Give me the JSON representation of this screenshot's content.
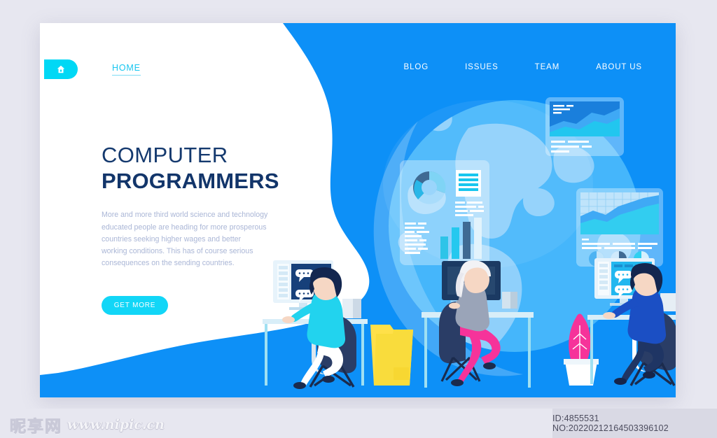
{
  "page": {
    "background_color": "#e7e7f0",
    "card_background": "#ffffff",
    "accent_blue": "#0d90f7",
    "accent_cyan": "#12d6f7",
    "headline_navy": "#12356a"
  },
  "header": {
    "logo_icon": "home-badge-icon",
    "home_label": "HOME",
    "nav_items": [
      {
        "label": "BLOG"
      },
      {
        "label": "ISSUES"
      },
      {
        "label": "TEAM"
      },
      {
        "label": "ABOUT US"
      }
    ]
  },
  "hero": {
    "title_line1": "COMPUTER",
    "title_line2": "PROGRAMMERS",
    "description": "More and more third world science and technology educated people are heading for more prosperous countries seeking higher wages and better working conditions. This has of course serious consequences on the sending countries.",
    "cta_label": "GET MORE"
  },
  "illustration": {
    "globe_label": "world-globe",
    "panels": [
      {
        "name": "analytics-panel-left",
        "widgets": [
          "donut-chart",
          "document-card",
          "text-lines",
          "bar-chart"
        ]
      },
      {
        "name": "analytics-panel-top-right",
        "widgets": [
          "area-chart",
          "text-lines"
        ]
      },
      {
        "name": "analytics-panel-bottom-right",
        "widgets": [
          "grid-area-chart",
          "text-lines",
          "pie-charts"
        ]
      }
    ],
    "workers": [
      {
        "name": "worker-cyan-shirt",
        "shirt_color": "#22d3ee",
        "hair_color": "#13264f"
      },
      {
        "name": "worker-blonde",
        "shirt_color": "#9aa4b8",
        "pants_color": "#f6339a"
      },
      {
        "name": "worker-blue-shirt",
        "shirt_color": "#1b4fc4",
        "hair_color": "#13264f"
      }
    ],
    "props": [
      "yellow-waste-bin",
      "pink-potted-plant",
      "desk",
      "office-chair",
      "monitor"
    ]
  },
  "watermark": {
    "site_cn": "昵享网",
    "site_url": "www.nipic.cn",
    "id_text": "ID:4855531 NO:20220212164503396102"
  }
}
